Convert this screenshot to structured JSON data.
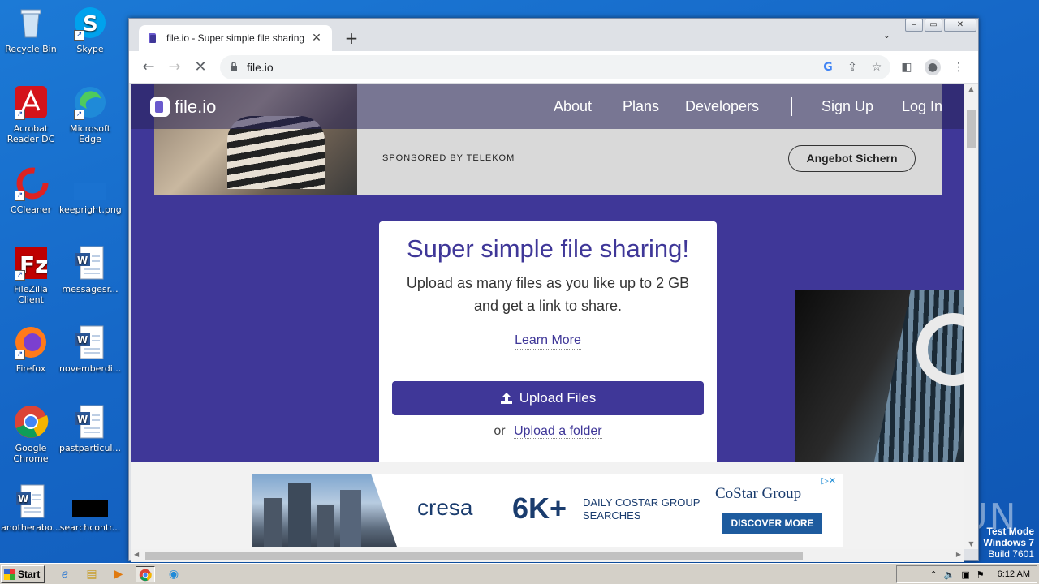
{
  "desktop": {
    "icons": [
      {
        "label": "Recycle Bin",
        "icon": "recycle-bin-icon"
      },
      {
        "label": "Skype",
        "icon": "skype-icon"
      },
      {
        "label": "Acrobat Reader DC",
        "icon": "acrobat-icon"
      },
      {
        "label": "Microsoft Edge",
        "icon": "edge-icon"
      },
      {
        "label": "CCleaner",
        "icon": "ccleaner-icon"
      },
      {
        "label": "keepright.png",
        "icon": "image-file-icon"
      },
      {
        "label": "FileZilla Client",
        "icon": "filezilla-icon"
      },
      {
        "label": "messagesr...",
        "icon": "word-doc-icon"
      },
      {
        "label": "Firefox",
        "icon": "firefox-icon"
      },
      {
        "label": "novemberdi...",
        "icon": "word-doc-icon"
      },
      {
        "label": "Google Chrome",
        "icon": "chrome-icon"
      },
      {
        "label": "pastparticul...",
        "icon": "word-doc-icon"
      },
      {
        "label": "anotherabo...",
        "icon": "word-doc-icon"
      },
      {
        "label": "searchcontr...",
        "icon": "black-file-icon"
      }
    ]
  },
  "browser": {
    "tab_title": "file.io - Super simple file sharing",
    "tab_close": "✕",
    "new_tab": "+",
    "url": "file.io"
  },
  "site": {
    "logo": "file.io",
    "nav": [
      "About",
      "Plans",
      "Developers",
      "Sign Up",
      "Log In"
    ],
    "ad_top": {
      "sponsor": "SPONSORED BY TELEKOM",
      "cta": "Angebot Sichern"
    },
    "card": {
      "title": "Super simple file sharing!",
      "subtitle_line1": "Upload as many files as you like up to 2 GB",
      "subtitle_line2": "and get a link to share.",
      "learn_more": "Learn More",
      "upload_button": "Upload Files",
      "or": "or",
      "upload_folder": "Upload a folder"
    },
    "banner": {
      "brand": "cresa",
      "big": "6K+",
      "desc": "DAILY COSTAR GROUP SEARCHES",
      "partner": "CoStar Group",
      "cta": "DISCOVER MORE"
    }
  },
  "watermark": {
    "text": "ANY RUN",
    "test_mode": "Test Mode",
    "os": "Windows 7",
    "build": "Build 7601"
  },
  "taskbar": {
    "start": "Start",
    "clock": "6:12 AM"
  },
  "colors": {
    "site_primary": "#3f3798",
    "desktop_bg": "#1668c8"
  }
}
